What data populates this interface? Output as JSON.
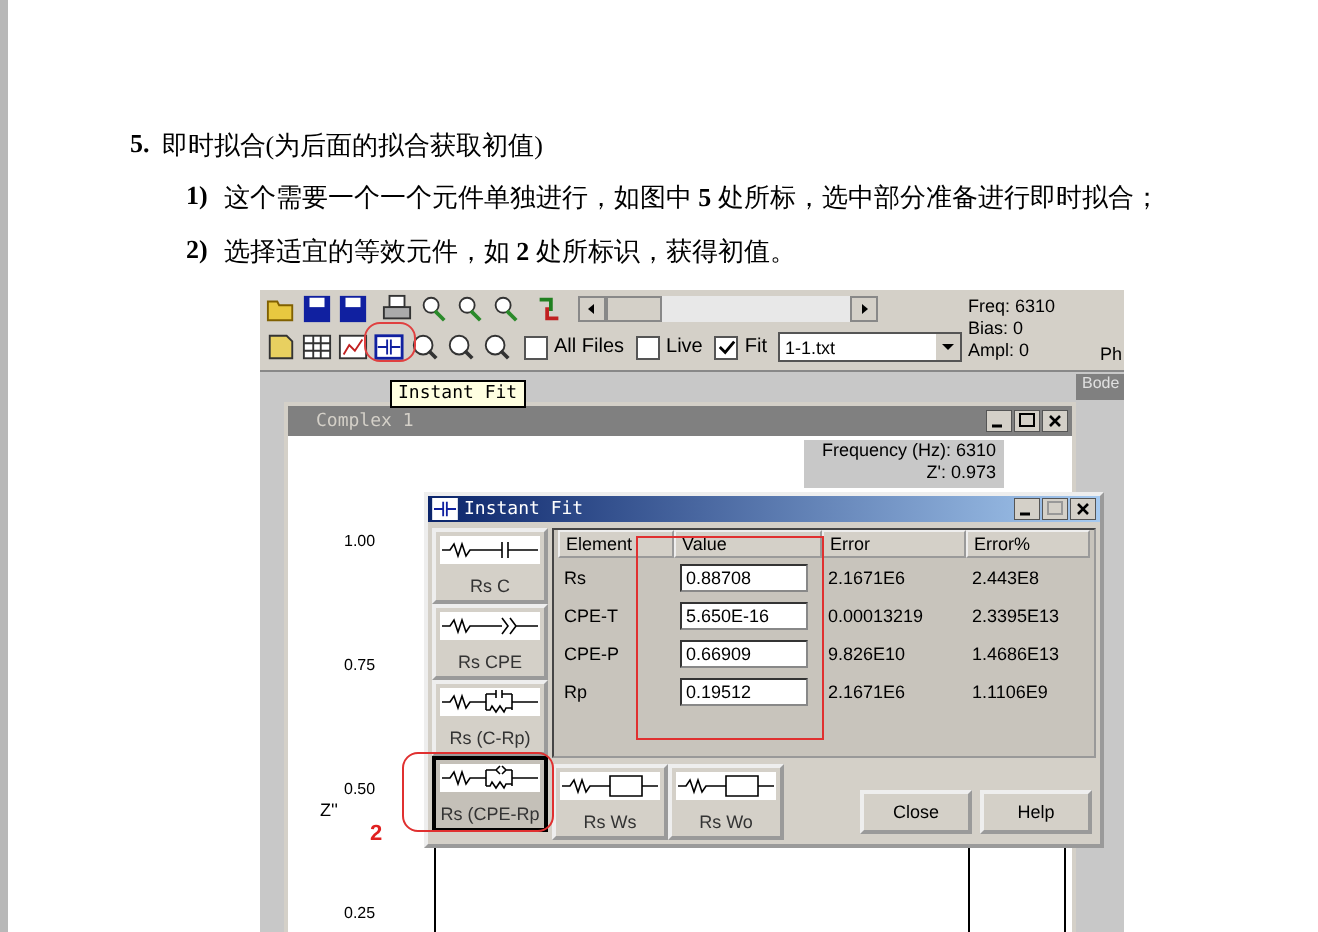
{
  "document": {
    "heading_number": "5.",
    "heading": "即时拟合(为后面的拟合获取初值)",
    "steps": [
      {
        "number": "1)",
        "text": "这个需要一个一个元件单独进行，如图中 **5** 处所标，选中部分准备进行即时拟合；"
      },
      {
        "number": "2)",
        "text": "选择适宜的等效元件，如 **2** 处所标识，获得初值。"
      }
    ]
  },
  "screenshot": {
    "toolbar": {
      "checkboxes": [
        {
          "label": "All Files",
          "checked": false
        },
        {
          "label": "Live",
          "checked": false
        },
        {
          "label": "Fit",
          "checked": true
        }
      ],
      "file_combo": {
        "value": "1-1.txt"
      },
      "readouts": [
        "Freq: 6310",
        "Bias: 0",
        "Ampl: 0"
      ],
      "cut_label": "Ph"
    },
    "tooltip": "Instant Fit",
    "minimized_window": {
      "title": "Bode"
    },
    "plot_window": {
      "title": "Complex 1",
      "y_axis_label": "Z''",
      "y_ticks": [
        "1.00",
        "0.75",
        "0.50",
        "0.25"
      ],
      "cursor_readout": [
        "Frequency (Hz): 6310",
        "Z': 0.973"
      ]
    },
    "dialog": {
      "title": "Instant Fit",
      "models": [
        {
          "label": "Rs C",
          "kind": "c",
          "selected": false
        },
        {
          "label": "Rs CPE",
          "kind": "cpe",
          "selected": false
        },
        {
          "label": "Rs (C-Rp)",
          "kind": "c-rp",
          "selected": false
        },
        {
          "label": "Rs (CPE-Rp",
          "kind": "cpe-rp",
          "selected": true
        },
        {
          "label": "Rs Ws",
          "kind": "ws",
          "selected": false
        },
        {
          "label": "Rs Wo",
          "kind": "wo",
          "selected": false
        }
      ],
      "table": {
        "columns": [
          "Element",
          "Value",
          "Error",
          "Error%"
        ],
        "rows": [
          {
            "element": "Rs",
            "value": "0.88708",
            "error": "2.1671E6",
            "error_pct": "2.443E8"
          },
          {
            "element": "CPE-T",
            "value": "5.650E-16",
            "error": "0.00013219",
            "error_pct": "2.3395E13"
          },
          {
            "element": "CPE-P",
            "value": "0.66909",
            "error": "9.826E10",
            "error_pct": "1.4686E13"
          },
          {
            "element": "Rp",
            "value": "0.19512",
            "error": "2.1671E6",
            "error_pct": "1.1106E9"
          }
        ]
      },
      "buttons": [
        "Close",
        "Help"
      ]
    },
    "annotation_label": "2"
  }
}
